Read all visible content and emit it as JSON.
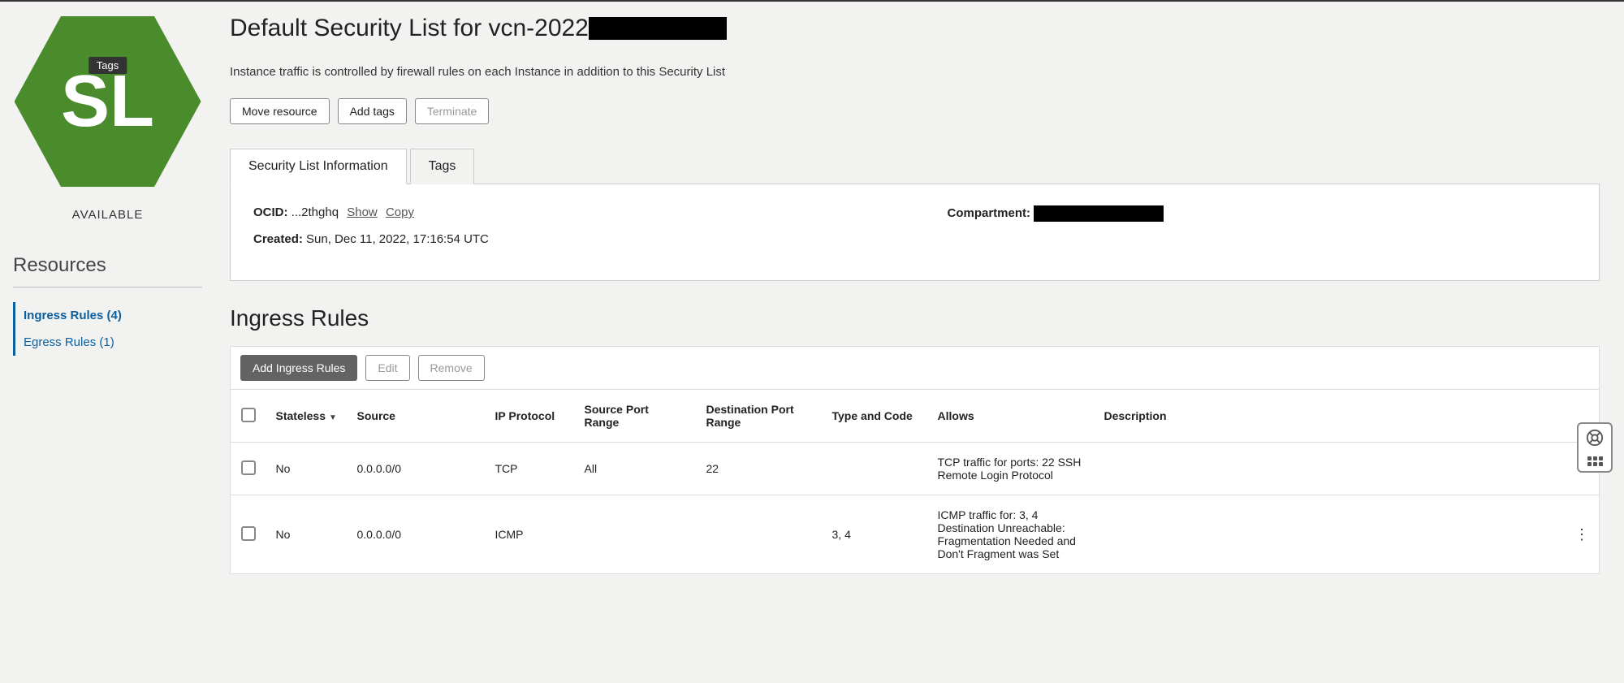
{
  "hexagon": {
    "abbrev": "SL",
    "badge": "Tags",
    "status": "AVAILABLE"
  },
  "resources": {
    "heading": "Resources",
    "items": [
      {
        "label": "Ingress Rules (4)",
        "active": true
      },
      {
        "label": "Egress Rules (1)",
        "active": false
      }
    ]
  },
  "header": {
    "title_prefix": "Default Security List for vcn-2022",
    "subtitle": "Instance traffic is controlled by firewall rules on each Instance in addition to this Security List"
  },
  "actions": {
    "move": "Move resource",
    "add_tags": "Add tags",
    "terminate": "Terminate"
  },
  "tabs": {
    "info": "Security List Information",
    "tags": "Tags"
  },
  "info": {
    "ocid_label": "OCID:",
    "ocid_value": "...2thghq",
    "show": "Show",
    "copy": "Copy",
    "created_label": "Created:",
    "created_value": "Sun, Dec 11, 2022, 17:16:54 UTC",
    "compartment_label": "Compartment:"
  },
  "ingress": {
    "heading": "Ingress Rules",
    "add": "Add Ingress Rules",
    "edit": "Edit",
    "remove": "Remove",
    "columns": {
      "stateless": "Stateless",
      "source": "Source",
      "protocol": "IP Protocol",
      "sport": "Source Port Range",
      "dport": "Destination Port Range",
      "type": "Type and Code",
      "allows": "Allows",
      "description": "Description"
    },
    "rows": [
      {
        "stateless": "No",
        "source": "0.0.0.0/0",
        "protocol": "TCP",
        "sport": "All",
        "dport": "22",
        "type": "",
        "allows": "TCP traffic for ports: 22 SSH Remote Login Protocol",
        "description": ""
      },
      {
        "stateless": "No",
        "source": "0.0.0.0/0",
        "protocol": "ICMP",
        "sport": "",
        "dport": "",
        "type": "3, 4",
        "allows": "ICMP traffic for: 3, 4 Destination Unreachable: Fragmentation Needed and Don't Fragment was Set",
        "description": ""
      }
    ]
  }
}
